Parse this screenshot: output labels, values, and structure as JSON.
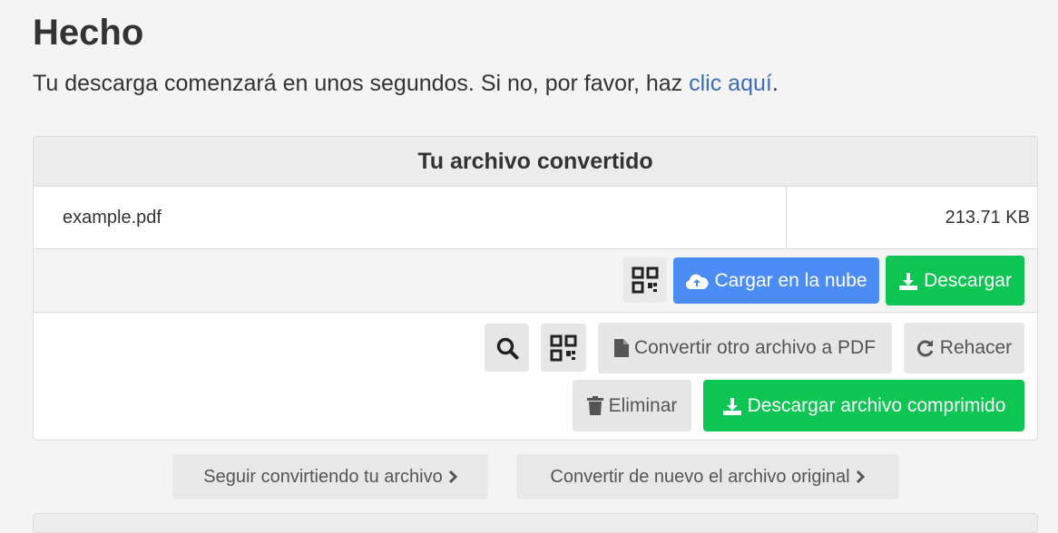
{
  "heading": "Hecho",
  "intro": {
    "text": "Tu descarga comenzará en unos segundos. Si no, por favor, haz ",
    "link": "clic aquí",
    "end": "."
  },
  "card": {
    "title": "Tu archivo convertido",
    "file_name": "example.pdf",
    "file_size": "213.71 KB",
    "upload_label": "Cargar en la nube",
    "download_label": "Descargar",
    "convert_other_label": "Convertir otro archivo a PDF",
    "redo_label": "Rehacer",
    "delete_label": "Eliminar",
    "download_zip_label": "Descargar archivo comprimido"
  },
  "footer_buttons": {
    "continue_label": "Seguir convirtiendo tu archivo",
    "reconvert_label": "Convertir de nuevo el archivo original"
  },
  "colors": {
    "blue": "#4b8bf4",
    "green": "#0cc552",
    "link": "#3d6db5"
  }
}
